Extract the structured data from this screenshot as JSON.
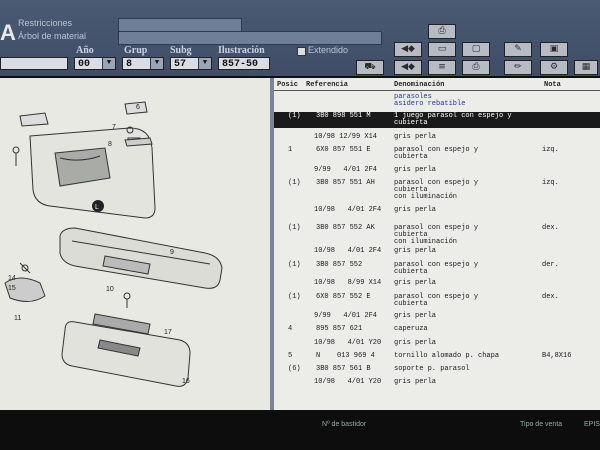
{
  "app": {
    "logo": "A",
    "labels": {
      "restrictions": "Restricciones",
      "material_tree": "Árbol de material",
      "extended": "Extendido"
    }
  },
  "selectors": {
    "headers": {
      "year": "Año",
      "group": "Grup",
      "subgroup": "Subg",
      "illustration": "Ilustración"
    },
    "values": {
      "year": "00",
      "group": "8",
      "subgroup": "57",
      "illustration": "857-50"
    }
  },
  "toolbar": {
    "icons": [
      "camera-icon",
      "nav-prev-icon",
      "folder-icon",
      "window-icon",
      "edit-icon",
      "print-icon",
      "car-icon",
      "pencil-icon",
      "image-icon"
    ]
  },
  "illustration_callouts": [
    "6",
    "7",
    "8",
    "L",
    "9",
    "10",
    "11",
    "14",
    "15",
    "16",
    "17"
  ],
  "list": {
    "headers": {
      "pos": "Posic",
      "ref": "Referencia",
      "desc": "Denominación",
      "note": "Nota"
    },
    "group_title_1": "parasoles",
    "group_title_2": "asidero rebatible",
    "rows": [
      {
        "pos": "(1)",
        "ref": "3B0 898 551 M",
        "desc": "1 juego parasol con espejo y",
        "desc2": "cubierta",
        "note": "",
        "selected": true
      },
      {
        "ref": "10/98 12/99 X14",
        "desc": "gris perla"
      },
      {
        "pos": "1",
        "ref": "6X0 857 551 E",
        "desc": "parasol con espejo y",
        "desc2": "cubierta",
        "note": "izq."
      },
      {
        "ref": "9/99   4/01 2F4",
        "desc": "gris perla"
      },
      {
        "pos": "(1)",
        "ref": "3B0 857 551 AH",
        "desc": "parasol con espejo y",
        "desc2": "cubierta",
        "desc3": "con iluminación",
        "note": "izq."
      },
      {
        "ref": "10/98   4/01 2F4",
        "desc": "gris perla"
      },
      {
        "pos": "(1)",
        "ref": "3B0 857 552 AK",
        "desc": "parasol con espejo y",
        "desc2": "cubierta",
        "desc3": "con iluminación",
        "note": "dex."
      },
      {
        "ref": "10/98   4/01 2F4",
        "desc": "gris perla"
      },
      {
        "pos": "(1)",
        "ref": "3B0 857 552",
        "desc": "parasol con espejo y",
        "desc2": "cubierta",
        "note": "der."
      },
      {
        "ref": "10/98   8/99 X14",
        "desc": "gris perla"
      },
      {
        "pos": "(1)",
        "ref": "6X0 857 552 E",
        "desc": "parasol con espejo y",
        "desc2": "cubierta",
        "note": "dex."
      },
      {
        "ref": "9/99   4/01 2F4",
        "desc": "gris perla"
      },
      {
        "pos": "4",
        "ref": "895 857 621",
        "desc": "caperuza"
      },
      {
        "ref": "10/98   4/01 Y20",
        "desc": "gris perla"
      },
      {
        "pos": "5",
        "ref": "N    013 969 4",
        "desc": "tornillo alomado p. chapa",
        "note": "B4,8X16"
      },
      {
        "pos": "(6)",
        "ref": "3B0 857 561 B",
        "desc": "soporte p. parasol"
      },
      {
        "ref": "10/98   4/01 Y20",
        "desc": "gris perla"
      }
    ]
  },
  "status": {
    "chassis": "Nº de bastidor",
    "sale_type": "Tipo de venta",
    "right": "EPIS"
  }
}
